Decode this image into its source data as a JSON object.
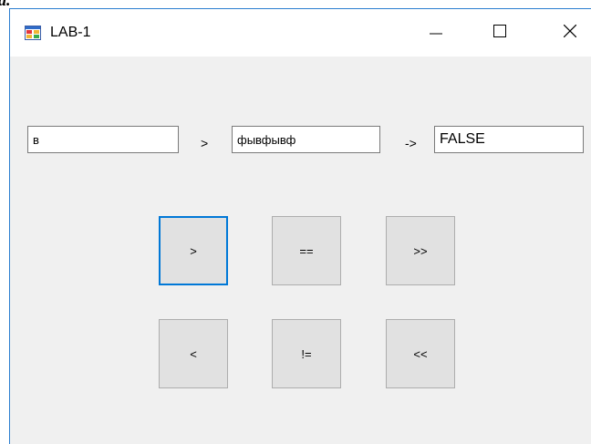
{
  "page_fragment_text": "a.",
  "window": {
    "title": "LAB-1",
    "icons": {
      "app": "app-window-icon",
      "minimize": "minimize-icon",
      "maximize": "maximize-icon",
      "close": "close-icon"
    },
    "accent_color": "#0078d7",
    "border_color": "#2d7fd0"
  },
  "inputs": {
    "left_value": "в",
    "middle_value": "фывфывф",
    "result_value": "FALSE"
  },
  "labels": {
    "operator": ">",
    "arrow": "->"
  },
  "buttons": {
    "greater": ">",
    "equal": "==",
    "shift_right": ">>",
    "less": "<",
    "not_equal": "!=",
    "shift_left": "<<"
  },
  "focused_button": "greater"
}
